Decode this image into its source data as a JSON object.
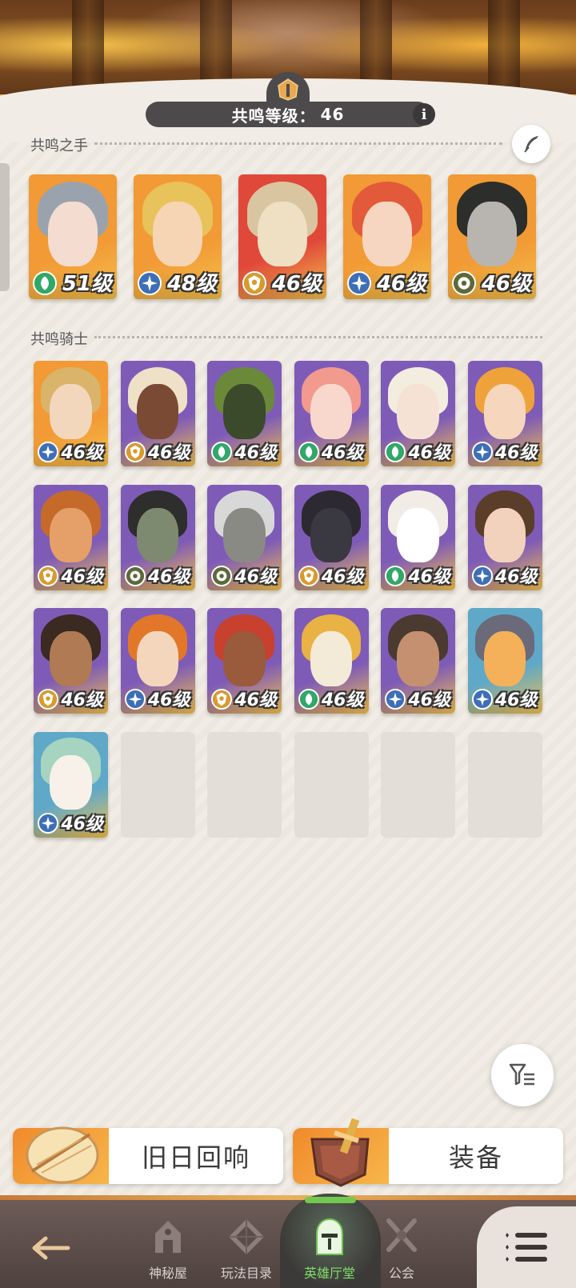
{
  "header": {
    "resonance_level_label": "共鸣等级：",
    "resonance_level_value": "46",
    "info_label": "i"
  },
  "sections": {
    "hands_title": "共鸣之手",
    "knights_title": "共鸣骑士"
  },
  "hands": [
    {
      "level": "51级",
      "class": "leaf",
      "bg": "#f29a35",
      "hair": "#9aa3ad",
      "skin": "#f4dcd0"
    },
    {
      "level": "48级",
      "class": "star",
      "bg": "#f29a35",
      "hair": "#e8c25a",
      "skin": "#f5d5b4"
    },
    {
      "level": "46级",
      "class": "shield",
      "bg": "#e0483a",
      "hair": "#d9c5a0",
      "skin": "#efe0c4"
    },
    {
      "level": "46级",
      "class": "star",
      "bg": "#f29a35",
      "hair": "#e25a3a",
      "skin": "#f6d6c0"
    },
    {
      "level": "46级",
      "class": "eye",
      "bg": "#f29a35",
      "hair": "#2b2e2a",
      "skin": "#b8b5b0"
    }
  ],
  "knights": [
    {
      "level": "46级",
      "class": "star",
      "bg": "#f29a35",
      "hair": "#d9b46a",
      "skin": "#f3d7bd"
    },
    {
      "level": "46级",
      "class": "shield",
      "bg": "#7e5bb7",
      "hair": "#efe0c8",
      "skin": "#7a4a34"
    },
    {
      "level": "46级",
      "class": "leaf",
      "bg": "#7e5bb7",
      "hair": "#6a8a3a",
      "skin": "#3a4a2a"
    },
    {
      "level": "46级",
      "class": "leaf",
      "bg": "#7e5bb7",
      "hair": "#f29a8e",
      "skin": "#f8d8cc"
    },
    {
      "level": "46级",
      "class": "leaf",
      "bg": "#7e5bb7",
      "hair": "#f3ede0",
      "skin": "#f6e2d4"
    },
    {
      "level": "46级",
      "class": "star",
      "bg": "#7e5bb7",
      "hair": "#f0a23a",
      "skin": "#f6d6bc"
    },
    {
      "level": "46级",
      "class": "shield",
      "bg": "#7e5bb7",
      "hair": "#c56a2a",
      "skin": "#e4a068"
    },
    {
      "level": "46级",
      "class": "eye",
      "bg": "#7e5bb7",
      "hair": "#2e2e2c",
      "skin": "#7d8a70"
    },
    {
      "level": "46级",
      "class": "eye",
      "bg": "#7e5bb7",
      "hair": "#d8d8d8",
      "skin": "#8a8a84"
    },
    {
      "level": "46级",
      "class": "shield",
      "bg": "#7e5bb7",
      "hair": "#2c2a30",
      "skin": "#3a3840"
    },
    {
      "level": "46级",
      "class": "leaf",
      "bg": "#7e5bb7",
      "hair": "#f1ede6",
      "skin": "#ffffff"
    },
    {
      "level": "46级",
      "class": "star",
      "bg": "#7e5bb7",
      "hair": "#5a3e2a",
      "skin": "#f2d2bc"
    },
    {
      "level": "46级",
      "class": "shield",
      "bg": "#7e5bb7",
      "hair": "#3a2a22",
      "skin": "#b07a54"
    },
    {
      "level": "46级",
      "class": "star",
      "bg": "#7e5bb7",
      "hair": "#e2772a",
      "skin": "#f4d6bc"
    },
    {
      "level": "46级",
      "class": "shield",
      "bg": "#7e5bb7",
      "hair": "#c8402e",
      "skin": "#9a5a3c"
    },
    {
      "level": "46级",
      "class": "leaf",
      "bg": "#7e5bb7",
      "hair": "#e8b244",
      "skin": "#f3ead8"
    },
    {
      "level": "46级",
      "class": "star",
      "bg": "#7e5bb7",
      "hair": "#4a3a30",
      "skin": "#c59070"
    },
    {
      "level": "46级",
      "class": "star",
      "bg": "#5fa8c8",
      "hair": "#6a6a7a",
      "skin": "#f5b05a"
    },
    {
      "level": "46级",
      "class": "star",
      "bg": "#5fa8c8",
      "hair": "#a6d4c0",
      "skin": "#f7f1ea"
    }
  ],
  "buttons": {
    "echo_label": "旧日回响",
    "equip_label": "装备"
  },
  "nav": {
    "items": [
      {
        "label": "神秘屋"
      },
      {
        "label": "玩法目录"
      },
      {
        "label": "英雄厅堂"
      },
      {
        "label": "公会"
      }
    ]
  },
  "class_colors": {
    "leaf": "#2fa86a",
    "star": "#3d6fb8",
    "shield": "#d89a2a",
    "eye": "#5a6a3a"
  }
}
